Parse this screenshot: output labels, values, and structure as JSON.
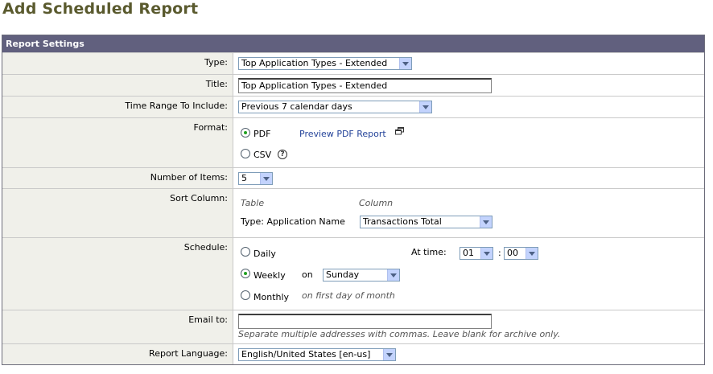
{
  "page": {
    "title": "Add Scheduled Report"
  },
  "panel": {
    "title": "Report Settings"
  },
  "type": {
    "label": "Type:",
    "value": "Top Application Types - Extended"
  },
  "title_field": {
    "label": "Title:",
    "value": "Top Application Types - Extended"
  },
  "time_range": {
    "label": "Time Range To Include:",
    "value": "Previous 7 calendar days"
  },
  "format": {
    "label": "Format:",
    "pdf": "PDF",
    "csv": "CSV",
    "preview_link": "Preview PDF Report",
    "help": "?",
    "selected": "PDF"
  },
  "num_items": {
    "label": "Number of Items:",
    "value": "5"
  },
  "sort_column": {
    "label": "Sort Column:",
    "table_header": "Table",
    "column_header": "Column",
    "row_label": "Type: Application Name",
    "value": "Transactions Total"
  },
  "schedule": {
    "label": "Schedule:",
    "daily": "Daily",
    "weekly": "Weekly",
    "monthly": "Monthly",
    "selected": "Weekly",
    "at_time_label": "At time:",
    "hour": "01",
    "sep": ":",
    "minute": "00",
    "on_label": "on",
    "day": "Sunday",
    "monthly_note": "on first day of month"
  },
  "email": {
    "label": "Email to:",
    "value": "",
    "hint": "Separate multiple addresses with commas. Leave blank for archive only."
  },
  "language": {
    "label": "Report Language:",
    "value": "English/United States [en-us]"
  },
  "colors": {
    "title": "#5a5a2e",
    "header_bg": "#61607e",
    "label_bg": "#f0f0ea",
    "link": "#25449a",
    "radio_dot": "#21a121"
  }
}
